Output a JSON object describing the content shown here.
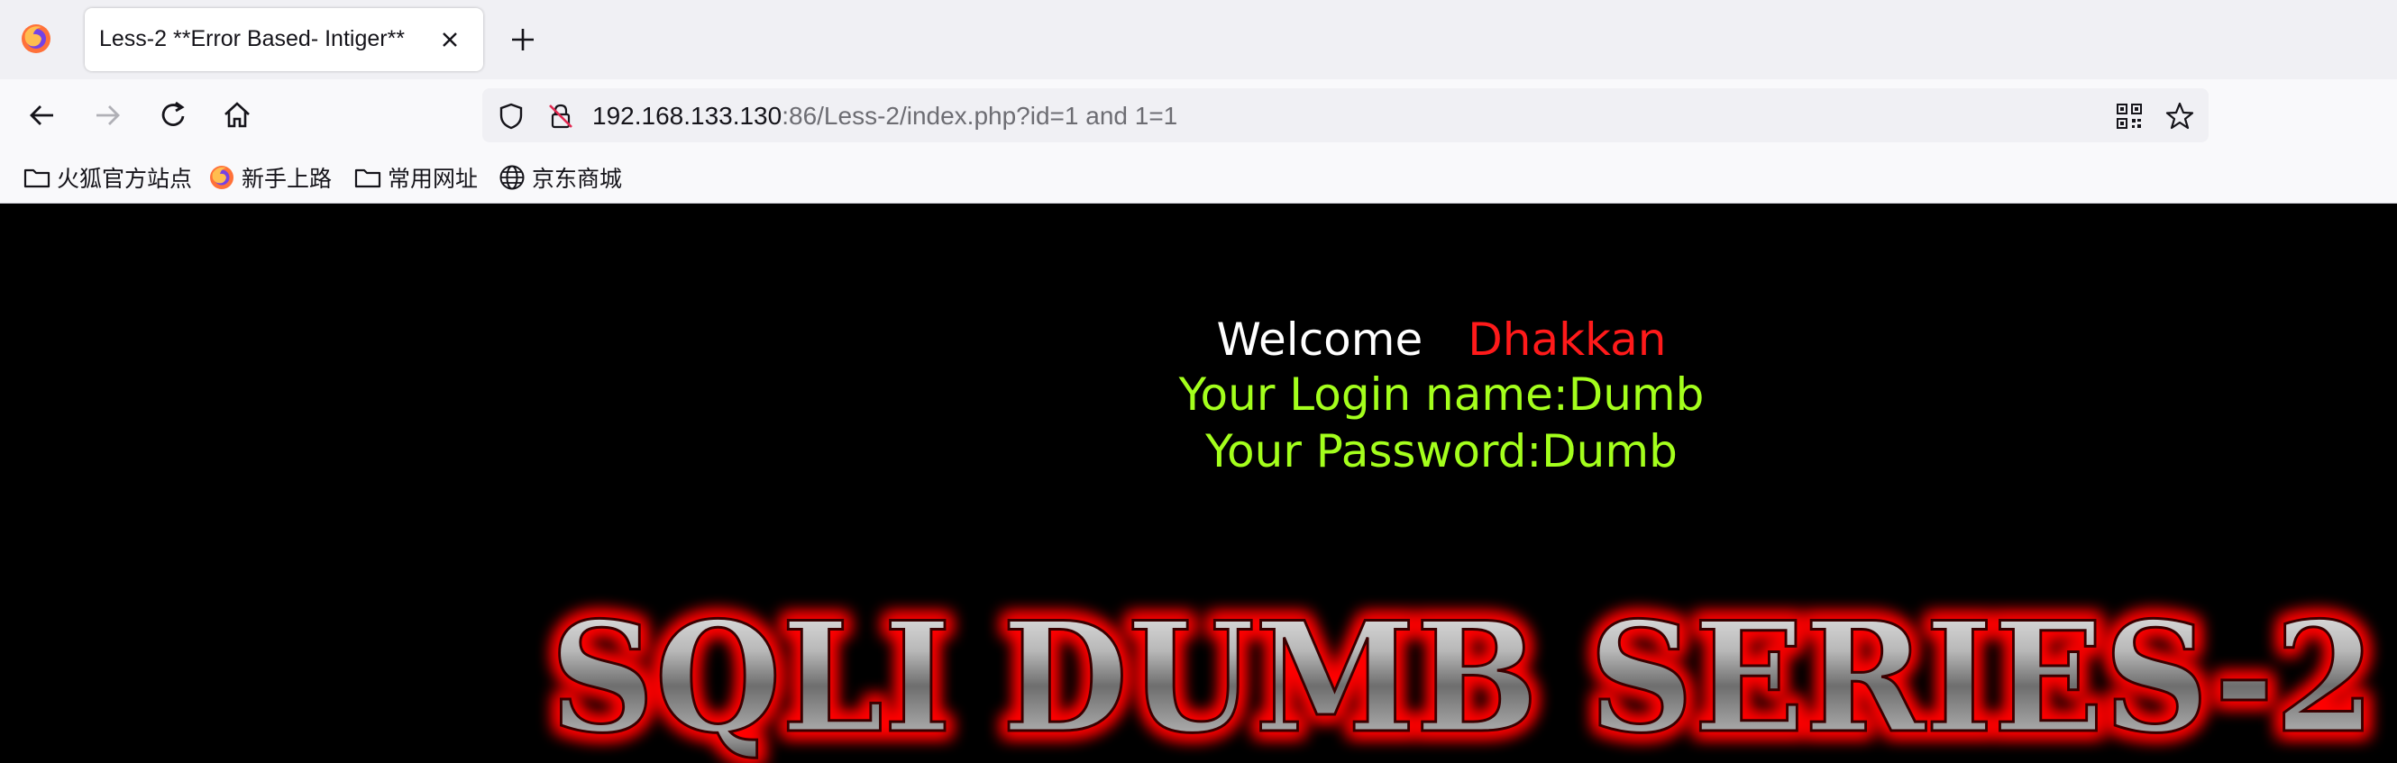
{
  "browser": {
    "tab_title": "Less-2 **Error Based- Intiger**",
    "url_host": "192.168.133.130",
    "url_rest": ":86/Less-2/index.php?id=1 and 1=1",
    "bookmarks": [
      {
        "label": "火狐官方站点",
        "icon": "folder-icon"
      },
      {
        "label": "新手上路",
        "icon": "firefox-icon"
      },
      {
        "label": "常用网址",
        "icon": "folder-icon"
      },
      {
        "label": "京东商城",
        "icon": "globe-icon"
      }
    ]
  },
  "page": {
    "welcome_word": "Welcome",
    "welcome_name": "Dhakkan",
    "login_line": "Your Login name:Dumb",
    "password_line": "Your Password:Dumb",
    "banner_text": "SQLI DUMB SERIES-2"
  },
  "colors": {
    "page_background": "#000000",
    "welcome_text": "#ffffff",
    "name_text": "#ff1a1a",
    "info_text": "#a4ff1c",
    "banner_glow": "#ff0000"
  }
}
